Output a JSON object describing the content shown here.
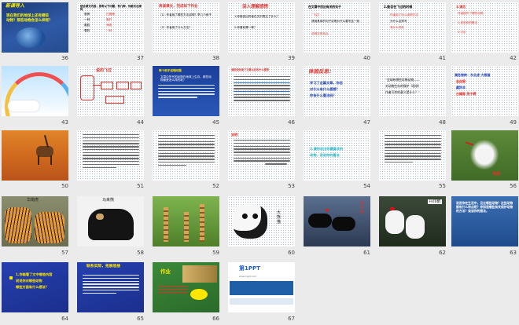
{
  "slides": [
    {
      "num": "36",
      "title": "新课导入",
      "lines": [
        "现在我们的地球上还有哪些",
        "动物？那些动物会怎么样呢？"
      ]
    },
    {
      "num": "37",
      "title": "结合课文内容，思考以下问题，有几种，你能写出来吗",
      "lines": [
        "·猞猁",
        "·白唇鹿",
        "·一种",
        "·鬣羚",
        "·戴胜",
        "·海燕",
        "·雪豹",
        "·一种"
      ]
    },
    {
      "num": "38",
      "title": "再读课文，完成如下作业",
      "lines": [
        "（1）作者用了哪些方法说明？举几个例子",
        "（2）作者用了什么方法？"
      ]
    },
    {
      "num": "39",
      "title": "深入理解感悟",
      "lines": [
        "1.你能说出作者在文中表达了什么？",
        "2.你喜欢哪一种？"
      ]
    },
    {
      "num": "40",
      "title": "在文章中找出有关的句子",
      "lines": [
        "“飞过”",
        "请用具体的句子说明为什么要写这一段",
        "说明文的特点"
      ]
    },
    {
      "num": "41",
      "title": "2.能否在飞过的时候",
      "lines": [
        "作者用了什么说明方法",
        "为什么这样写",
        "有什么好处"
      ]
    },
    {
      "num": "42",
      "title": "3.课后",
      "lines": [
        "作者描写了哪些动物，",
        "2.说说你的看法",
        "3.讨论"
      ]
    },
    {
      "num": "43",
      "title": "",
      "lines": []
    },
    {
      "num": "44",
      "title": "说的飞过",
      "lines": []
    },
    {
      "num": "45",
      "title": "举个例子说明问题",
      "lines": [
        "文章中所写的动物在地球上生存，那些动物都是怎么样的呢？"
      ]
    },
    {
      "num": "46",
      "title": "请说说你读了文章以后有什么感想",
      "lines": []
    },
    {
      "num": "47",
      "title": "体验反思：",
      "lines": [
        "学习了这篇文章，你会",
        "对什么有什么感想？",
        "你有什么看法吗？"
      ]
    },
    {
      "num": "48",
      "title": "",
      "lines": [
        "“全球有哪些珍稀动物——",
        "对动物生存的保护（现状）",
        "作者写作的意义是什么？”"
      ]
    },
    {
      "num": "49",
      "title": "",
      "lines": [
        "濒危物种：东北虎 大熊猫",
        "金丝猴",
        "藏羚羊",
        "白鳍豚 扬子鳄"
      ]
    },
    {
      "num": "50",
      "title": "",
      "lines": []
    },
    {
      "num": "51",
      "title": "",
      "lines": []
    },
    {
      "num": "52",
      "title": "",
      "lines": []
    },
    {
      "num": "53",
      "title": "说明：",
      "lines": []
    },
    {
      "num": "54",
      "title": "",
      "lines": [
        "2.请你说出你最喜欢的",
        "动物，说说你的看法"
      ]
    },
    {
      "num": "55",
      "title": "",
      "lines": []
    },
    {
      "num": "56",
      "title": "",
      "lines": [
        "朱鹮"
      ]
    },
    {
      "num": "57",
      "title": "",
      "lines": [
        "华南虎"
      ]
    },
    {
      "num": "58",
      "title": "",
      "lines": [
        "马来熊"
      ]
    },
    {
      "num": "59",
      "title": "",
      "lines": []
    },
    {
      "num": "60",
      "title": "",
      "lines": [
        "大熊猫"
      ]
    },
    {
      "num": "61",
      "title": "",
      "lines": [
        "黑天鹅"
      ]
    },
    {
      "num": "62",
      "title": "",
      "lines": [
        "丹顶鹤"
      ]
    },
    {
      "num": "63",
      "title": "",
      "lines": [
        "说说你在生活中，见过哪些动物？这些动物都有什么特点呢？你知道哪些有关保护动物的方法？谈谈你的看法。"
      ]
    },
    {
      "num": "64",
      "title": "",
      "lines": [
        "1.你能看了文中哪些内容",
        "说说你对哪些动物",
        "哪些方面有什么想法？"
      ]
    },
    {
      "num": "65",
      "title": "联系实际，拓展思维",
      "lines": []
    },
    {
      "num": "66",
      "title": "作业",
      "lines": []
    },
    {
      "num": "67",
      "title": "第1PPT",
      "lines": [
        "www.1ppt.com"
      ]
    }
  ],
  "colors": {
    "red": "#e0312b",
    "blue": "#1e3fb8",
    "yellow": "#ffe600",
    "green": "#1fb51a",
    "purple": "#7a2cc0"
  }
}
